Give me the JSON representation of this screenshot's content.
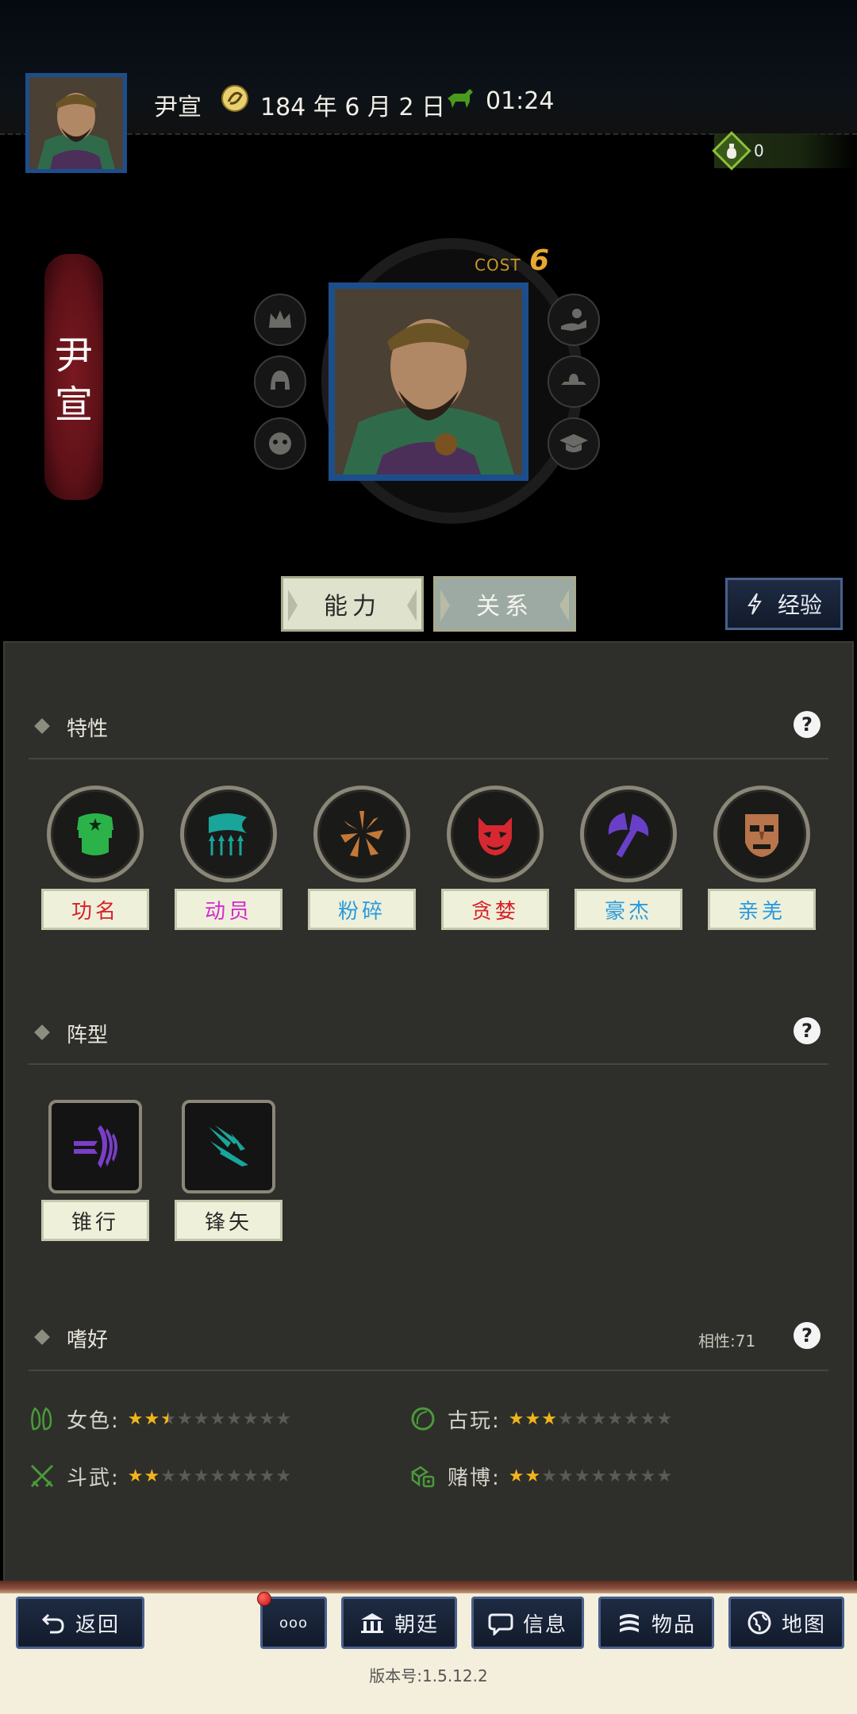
{
  "header": {
    "name": "尹宣",
    "date": "184 年 6 月 2 日",
    "time": "01:24",
    "resource_value": "0"
  },
  "hero": {
    "name_chars": [
      "尹",
      "宣"
    ],
    "cost_label": "COST",
    "cost_value": "6"
  },
  "tabs": {
    "ability": "能力",
    "relation": "关系",
    "experience": "经验"
  },
  "traits": {
    "title": "特性",
    "items": [
      {
        "label": "功名",
        "color": "#d8202a",
        "icon": "soldier-cap-icon"
      },
      {
        "label": "动员",
        "color": "#d42ad0",
        "icon": "banner-arrows-icon"
      },
      {
        "label": "粉碎",
        "color": "#2a9ae0",
        "icon": "shatter-icon"
      },
      {
        "label": "贪婪",
        "color": "#d8202a",
        "icon": "demon-mask-icon"
      },
      {
        "label": "豪杰",
        "color": "#2a9ae0",
        "icon": "battle-axe-icon"
      },
      {
        "label": "亲羌",
        "color": "#2a9ae0",
        "icon": "tribal-mask-icon"
      }
    ]
  },
  "formations": {
    "title": "阵型",
    "items": [
      {
        "label": "锥行",
        "icon": "wedge-formation-icon"
      },
      {
        "label": "锋矢",
        "icon": "arrow-formation-icon"
      }
    ]
  },
  "hobbies": {
    "title": "嗜好",
    "affinity": "相性:71",
    "items": [
      {
        "label": "女色:",
        "rating": 2.5,
        "max": 10,
        "icon": "slippers-icon"
      },
      {
        "label": "古玩:",
        "rating": 3,
        "max": 10,
        "icon": "jade-ring-icon"
      },
      {
        "label": "斗武:",
        "rating": 2,
        "max": 10,
        "icon": "crossed-swords-icon"
      },
      {
        "label": "赌博:",
        "rating": 2,
        "max": 10,
        "icon": "dice-icon"
      }
    ]
  },
  "nav": {
    "back": "返回",
    "more": "ooo",
    "court": "朝廷",
    "info": "信息",
    "items": "物品",
    "map": "地图"
  },
  "version": "版本号:1.5.12.2"
}
